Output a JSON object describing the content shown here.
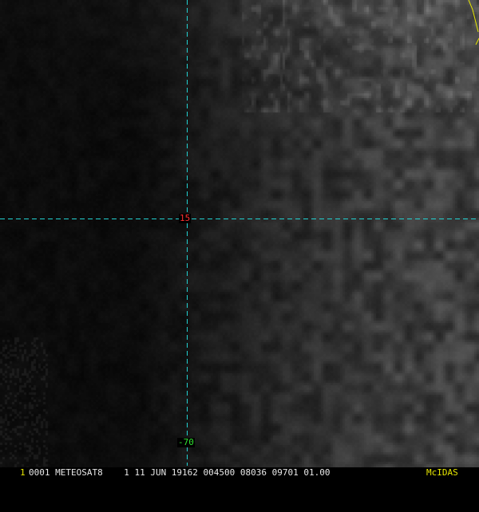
{
  "image": {
    "kind": "Meteosat-8 infrared/visible satellite frame",
    "background_color": "#000000"
  },
  "grid": {
    "line_color": "#22d3d3",
    "latitude_label": "15",
    "latitude_label_color": "#ff3030",
    "longitude_label": "-70",
    "longitude_label_color": "#30e030"
  },
  "coastline": {
    "color": "#e6e600"
  },
  "caption": {
    "frame_number": "1",
    "frame_number_color": "#e6e600",
    "text": "0001 METEOSAT8    1 11 JUN 19162 004500 08036 09701 01.00",
    "text_color": "#e8e8e8",
    "logo": "McIDAS",
    "logo_color": "#e6e600"
  }
}
